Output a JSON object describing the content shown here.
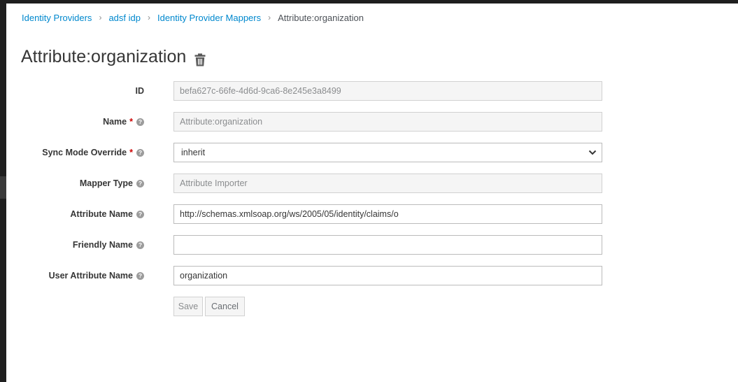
{
  "breadcrumb": {
    "items": [
      "Identity Providers",
      "adsf idp",
      "Identity Provider Mappers"
    ],
    "current": "Attribute:organization",
    "separator": "›"
  },
  "page": {
    "title": "Attribute:organization",
    "delete_icon": "trash-icon"
  },
  "form": {
    "id": {
      "label": "ID",
      "value": "befa627c-66fe-4d6d-9ca6-8e245e3a8499"
    },
    "name": {
      "label": "Name",
      "required_mark": "*",
      "value": "Attribute:organization"
    },
    "sync_mode": {
      "label": "Sync Mode Override",
      "required_mark": "*",
      "value": "inherit"
    },
    "mapper_type": {
      "label": "Mapper Type",
      "value": "Attribute Importer"
    },
    "attribute_name": {
      "label": "Attribute Name",
      "value": "http://schemas.xmlsoap.org/ws/2005/05/identity/claims/o"
    },
    "friendly_name": {
      "label": "Friendly Name",
      "value": ""
    },
    "user_attribute_name": {
      "label": "User Attribute Name",
      "value": "organization"
    },
    "help_icon_glyph": "?"
  },
  "buttons": {
    "save_label": "Save",
    "cancel_label": "Cancel"
  },
  "colors": {
    "link": "#0088ce",
    "required": "#cc0000",
    "readonly_bg": "#f5f5f5"
  }
}
